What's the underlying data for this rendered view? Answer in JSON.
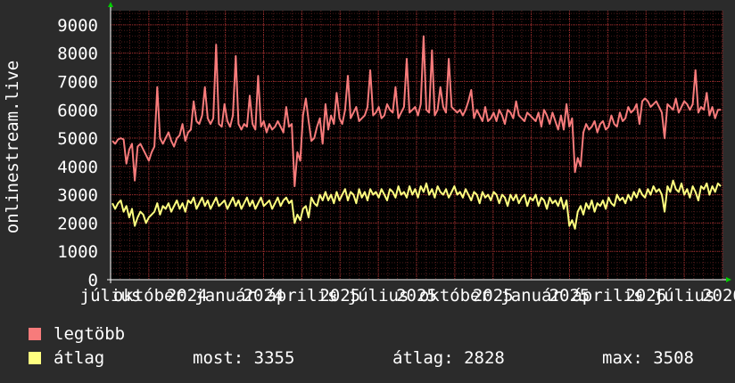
{
  "chart_data": {
    "type": "line",
    "ylabel": "onlinestream.live",
    "ylim": [
      0,
      9500
    ],
    "yticks": [
      0,
      1000,
      2000,
      3000,
      4000,
      5000,
      6000,
      7000,
      8000,
      9000
    ],
    "grid": true,
    "xticks": [
      {
        "t": 0.0,
        "label": "július"
      },
      {
        "t": 0.25,
        "label": "október"
      },
      {
        "t": 0.5,
        "label": "2024"
      },
      {
        "t": 0.75,
        "label": "január"
      },
      {
        "t": 1.0,
        "label": "2024"
      },
      {
        "t": 1.25,
        "label": "április"
      },
      {
        "t": 1.5,
        "label": "2025"
      },
      {
        "t": 1.75,
        "label": "július"
      },
      {
        "t": 2.0,
        "label": "2025"
      },
      {
        "t": 2.25,
        "label": "október"
      },
      {
        "t": 2.5,
        "label": "2025"
      },
      {
        "t": 2.75,
        "label": "január"
      },
      {
        "t": 3.0,
        "label": "2025"
      },
      {
        "t": 3.25,
        "label": "április"
      },
      {
        "t": 3.5,
        "label": "2026"
      },
      {
        "t": 3.75,
        "label": "július"
      },
      {
        "t": 4.0,
        "label": "2026"
      }
    ],
    "series": [
      {
        "name": "legtöbb",
        "color": "#f77b7b",
        "values": [
          4900,
          4800,
          4950,
          5000,
          4950,
          4100,
          4600,
          4800,
          3500,
          4700,
          4800,
          4600,
          4400,
          4200,
          4500,
          4700,
          6800,
          5000,
          4800,
          5000,
          5200,
          4900,
          4700,
          5000,
          5100,
          5500,
          4900,
          5200,
          5300,
          6300,
          5600,
          5500,
          5800,
          6800,
          5700,
          5500,
          5700,
          8300,
          5500,
          5400,
          6200,
          5600,
          5400,
          5800,
          7900,
          5500,
          5300,
          5500,
          5400,
          6500,
          5500,
          5300,
          7200,
          5400,
          5600,
          5200,
          5500,
          5300,
          5400,
          5600,
          5400,
          5200,
          6100,
          5400,
          5500,
          3300,
          4500,
          4200,
          5800,
          6400,
          5600,
          4900,
          5000,
          5400,
          5700,
          4800,
          6200,
          5300,
          5800,
          5500,
          6600,
          5700,
          5500,
          6000,
          7200,
          5700,
          5900,
          6100,
          5600,
          5700,
          5800,
          6100,
          7400,
          5800,
          5900,
          6100,
          5700,
          5800,
          6200,
          6000,
          5900,
          6800,
          5700,
          5900,
          6100,
          7800,
          5900,
          6000,
          6100,
          5800,
          6200,
          8600,
          6000,
          5900,
          8100,
          5800,
          6000,
          6800,
          6100,
          5900,
          7800,
          6100,
          6000,
          5900,
          6000,
          5800,
          6000,
          6300,
          6700,
          5700,
          6000,
          5800,
          5600,
          6100,
          5600,
          5700,
          5900,
          5600,
          6000,
          5800,
          5500,
          6000,
          5900,
          5700,
          6300,
          5800,
          5700,
          5600,
          5900,
          5800,
          5700,
          5600,
          5900,
          5400,
          6000,
          5800,
          5500,
          5900,
          5600,
          5300,
          5800,
          5300,
          6200,
          5400,
          5700,
          3800,
          4300,
          4000,
          5200,
          5500,
          5300,
          5400,
          5600,
          5200,
          5500,
          5600,
          5300,
          5400,
          5800,
          5500,
          5400,
          5900,
          5600,
          5700,
          6100,
          5900,
          6000,
          6200,
          5500,
          6300,
          6400,
          6300,
          6100,
          6200,
          6300,
          6100,
          5900,
          5000,
          6200,
          6100,
          6000,
          6400,
          5900,
          6100,
          6300,
          6200,
          6000,
          6200,
          7400,
          5900,
          6100,
          6000,
          6600,
          5800,
          6100,
          5700,
          6000,
          6000
        ]
      },
      {
        "name": "átlag",
        "color": "#ffff80",
        "values": [
          2700,
          2500,
          2700,
          2800,
          2400,
          2600,
          2200,
          2500,
          1900,
          2200,
          2400,
          2300,
          2000,
          2200,
          2300,
          2400,
          2700,
          2300,
          2600,
          2500,
          2700,
          2400,
          2600,
          2800,
          2500,
          2700,
          2400,
          2800,
          2700,
          2900,
          2500,
          2700,
          2900,
          2600,
          2800,
          2500,
          2700,
          2900,
          2600,
          2700,
          2800,
          2500,
          2700,
          2900,
          2600,
          2800,
          2500,
          2700,
          2900,
          2600,
          2800,
          2500,
          2700,
          2900,
          2600,
          2700,
          2800,
          2500,
          2700,
          2900,
          2600,
          2800,
          2900,
          2700,
          2800,
          2000,
          2300,
          2100,
          2500,
          2600,
          2200,
          2900,
          2700,
          2600,
          3000,
          2800,
          3100,
          2800,
          3000,
          2700,
          3100,
          2800,
          3000,
          3200,
          2800,
          3100,
          3000,
          2700,
          3200,
          2900,
          3100,
          2800,
          3200,
          3000,
          3100,
          2900,
          3200,
          3000,
          2800,
          3200,
          3100,
          2900,
          3300,
          3000,
          3100,
          2900,
          3300,
          3000,
          3200,
          2900,
          3300,
          3100,
          3400,
          3000,
          3200,
          2900,
          3300,
          3100,
          3000,
          3200,
          2900,
          3100,
          3300,
          3000,
          3100,
          2900,
          3200,
          3000,
          2800,
          3100,
          3000,
          2700,
          3100,
          2900,
          3000,
          2800,
          3100,
          3000,
          2700,
          3000,
          2900,
          2600,
          3000,
          2800,
          3000,
          2700,
          2900,
          3000,
          2600,
          2900,
          2800,
          3000,
          2600,
          2900,
          2800,
          2500,
          2900,
          2700,
          2800,
          2600,
          2900,
          2500,
          2800,
          1900,
          2100,
          1800,
          2400,
          2600,
          2300,
          2700,
          2500,
          2800,
          2400,
          2700,
          2600,
          2800,
          2500,
          2900,
          2700,
          2600,
          3000,
          2800,
          2900,
          2700,
          3000,
          2800,
          3100,
          2900,
          3200,
          3000,
          2900,
          3200,
          3000,
          3300,
          3100,
          3200,
          3000,
          2400,
          3300,
          3100,
          3500,
          3200,
          3100,
          3400,
          3000,
          3200,
          2900,
          3300,
          3100,
          2800,
          3300,
          3200,
          3400,
          3000,
          3300,
          3100,
          3400,
          3300
        ]
      }
    ]
  },
  "legend": {
    "max_label": "legtöbb",
    "avg_label": "átlag",
    "now_text": "most: 3355",
    "avg_text": "átlag: 2828",
    "max_text": "max: 3508"
  }
}
